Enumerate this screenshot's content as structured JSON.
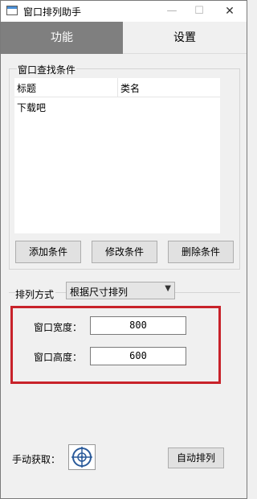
{
  "window": {
    "title": "窗口排列助手"
  },
  "titlebar": {
    "min_glyph": "—",
    "max_glyph": "☐",
    "close_glyph": "✕"
  },
  "tabs": [
    {
      "label": "功能",
      "active": true
    },
    {
      "label": "设置",
      "active": false
    }
  ],
  "search_group": {
    "title": "窗口查找条件",
    "columns": [
      "标题",
      "类名"
    ],
    "rows": [
      {
        "title": "下载吧",
        "class": ""
      }
    ],
    "buttons": {
      "add": "添加条件",
      "edit": "修改条件",
      "delete": "删除条件"
    }
  },
  "arrange": {
    "label": "排列方式",
    "selected": "根据尺寸排列",
    "width_label": "窗口宽度：",
    "width_value": "800",
    "height_label": "窗口高度：",
    "height_value": "600"
  },
  "bottom": {
    "manual_label": "手动获取：",
    "auto_button": "自动排列"
  },
  "colors": {
    "active_tab": "#7f7f7f",
    "highlight_border": "#c8222a"
  }
}
